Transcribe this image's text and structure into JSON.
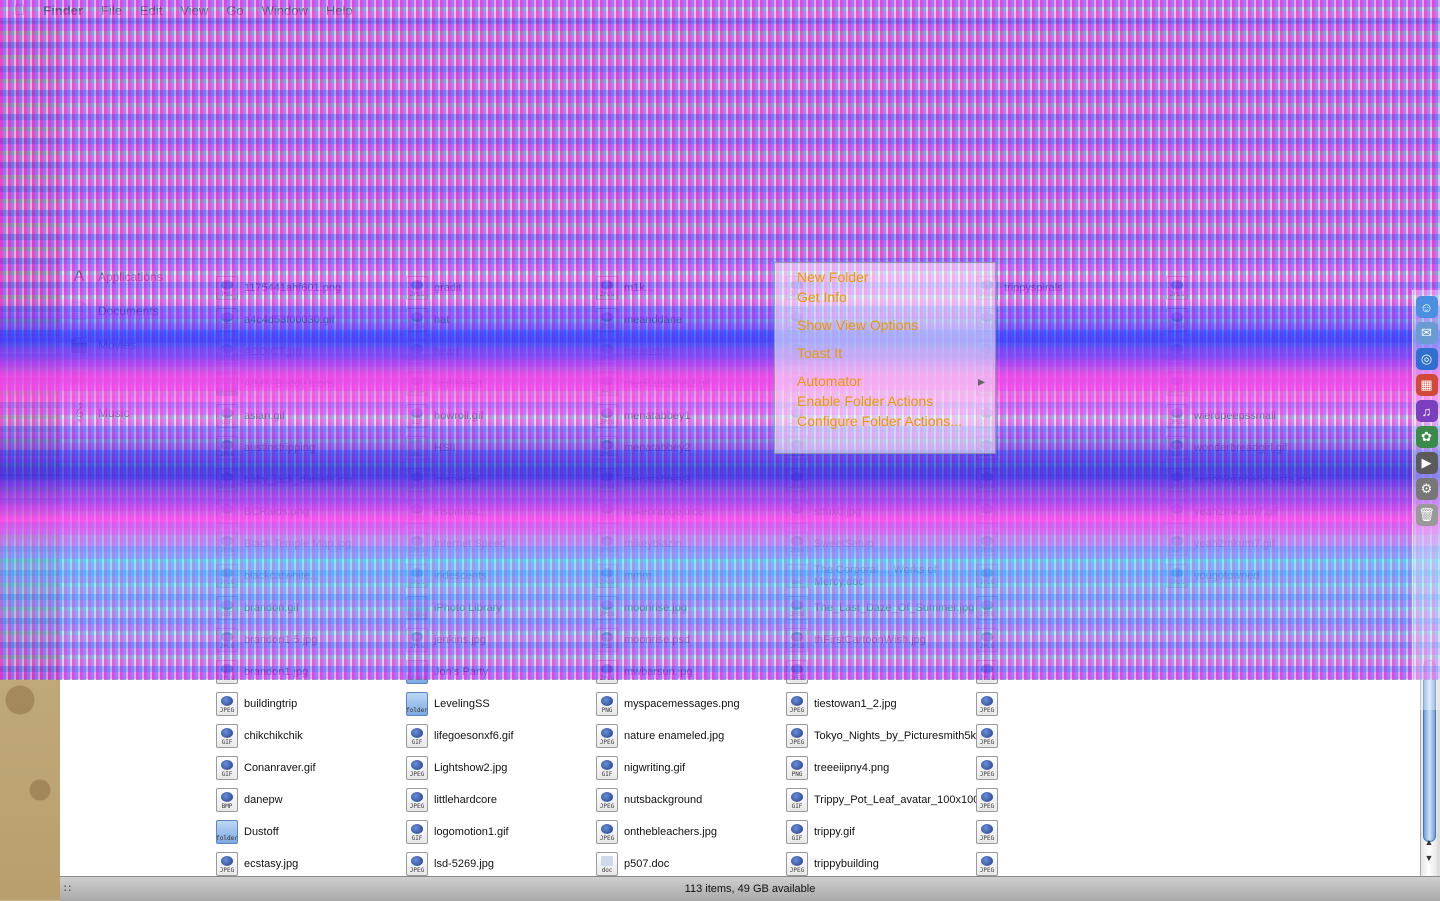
{
  "menubar": {
    "items": [
      "",
      "Finder",
      "File",
      "Edit",
      "View",
      "Go",
      "Window",
      "Help"
    ]
  },
  "sidebar": {
    "items": [
      {
        "label": "Applications",
        "icon": "applications-icon"
      },
      {
        "label": "Documents",
        "icon": "documents-icon"
      },
      {
        "label": "Movies",
        "icon": "movies-icon"
      },
      {
        "label": "",
        "icon": "folder-icon"
      },
      {
        "label": "Music",
        "icon": "music-icon"
      }
    ]
  },
  "files": [
    {
      "name": "1175441ahf601.png",
      "kind": "PNG"
    },
    {
      "name": "a4c4d53f00030.gif",
      "kind": "GIF"
    },
    {
      "name": "ADDICT.jpg",
      "kind": "JPEG"
    },
    {
      "name": "AIM® Buddy Icons",
      "kind": "folder"
    },
    {
      "name": "asian.gif",
      "kind": "GIF"
    },
    {
      "name": "austinstripping",
      "kind": "JPEG"
    },
    {
      "name": "baby_jack_daniels.jpg",
      "kind": "JPEG"
    },
    {
      "name": "BCRaids.png",
      "kind": "PNG"
    },
    {
      "name": "Black Temple Map.jpg",
      "kind": "JPEG"
    },
    {
      "name": "blackcatwhite...",
      "kind": "JPEG"
    },
    {
      "name": "brandon.gif",
      "kind": "GIF"
    },
    {
      "name": "brandon1.5.jpg",
      "kind": "JPEG"
    },
    {
      "name": "brandon1.jpg",
      "kind": "JPEG"
    },
    {
      "name": "buildingtrip",
      "kind": "JPEG"
    },
    {
      "name": "chikchikchik",
      "kind": "GIF"
    },
    {
      "name": "Conanraver.gif",
      "kind": "GIF"
    },
    {
      "name": "danepw",
      "kind": "BMP"
    },
    {
      "name": "Dustoff",
      "kind": "folder"
    },
    {
      "name": "ecstasy.jpg",
      "kind": "JPEG"
    },
    {
      "name": "gradit",
      "kind": "JPEG"
    },
    {
      "name": "hat",
      "kind": "JPEG"
    },
    {
      "name": "heart",
      "kind": "JPEG"
    },
    {
      "name": "highforest",
      "kind": "JPEG"
    },
    {
      "name": "howroll.gif",
      "kind": "GIF"
    },
    {
      "name": "HSII",
      "kind": "doc"
    },
    {
      "name": "imspecial",
      "kind": "JPEG"
    },
    {
      "name": "insomnia...",
      "kind": "JPEG"
    },
    {
      "name": "Internet Speed",
      "kind": "JPEG"
    },
    {
      "name": "iridescents",
      "kind": "JPEG"
    },
    {
      "name": "iPhoto Library",
      "kind": "folder"
    },
    {
      "name": "jenkins.jpg",
      "kind": "JPEG"
    },
    {
      "name": "Jon's Party",
      "kind": "folder"
    },
    {
      "name": "LevelingSS",
      "kind": "folder"
    },
    {
      "name": "lifegoesonxf6.gif",
      "kind": "GIF"
    },
    {
      "name": "Lightshow2.jpg",
      "kind": "JPEG"
    },
    {
      "name": "littlehardcore",
      "kind": "JPEG"
    },
    {
      "name": "logomotion1.gif",
      "kind": "GIF"
    },
    {
      "name": "lsd-5269.jpg",
      "kind": "JPEG"
    },
    {
      "name": "m1k...",
      "kind": "JPEG"
    },
    {
      "name": "meanddane",
      "kind": "JPEG"
    },
    {
      "name": "meaustin",
      "kind": "JPEG"
    },
    {
      "name": "meditate2this2.gif",
      "kind": "GIF"
    },
    {
      "name": "menatabbey1",
      "kind": "JPEG"
    },
    {
      "name": "menatabbey2",
      "kind": "JPEG"
    },
    {
      "name": "menatabbey3",
      "kind": "JPEG"
    },
    {
      "name": "mikeorangejuice",
      "kind": "JPEG"
    },
    {
      "name": "mikeyblazin...",
      "kind": "JPEG"
    },
    {
      "name": "mmm",
      "kind": "JPEG"
    },
    {
      "name": "moonrise.jpg",
      "kind": "JPEG"
    },
    {
      "name": "moonrise.psd",
      "kind": "PSD"
    },
    {
      "name": "mwbarsun.jpg",
      "kind": "JPEG"
    },
    {
      "name": "myspacemessages.png",
      "kind": "PNG"
    },
    {
      "name": "nature enameled.jpg",
      "kind": "JPEG"
    },
    {
      "name": "nigwriting.gif",
      "kind": "GIF"
    },
    {
      "name": "nutsbackground",
      "kind": "JPEG"
    },
    {
      "name": "onthebleachers.jpg",
      "kind": "JPEG"
    },
    {
      "name": "p507.doc",
      "kind": "doc"
    },
    {
      "name": "",
      "kind": "JPEG"
    },
    {
      "name": "",
      "kind": "JPEG"
    },
    {
      "name": "",
      "kind": "JPEG"
    },
    {
      "name": "",
      "kind": "JPEG"
    },
    {
      "name": "",
      "kind": "JPEG"
    },
    {
      "name": "",
      "kind": "JPEG"
    },
    {
      "name": "",
      "kind": "JPEG"
    },
    {
      "name": "stfux0.jpg",
      "kind": "JPEG"
    },
    {
      "name": "SweetSetup",
      "kind": "JPEG"
    },
    {
      "name": "The Corporal ... Works of Mercy.doc",
      "kind": "doc"
    },
    {
      "name": "The_Last_Daze_Of_Summer.jpg",
      "kind": "JPEG"
    },
    {
      "name": "thFirstCartoonWish.jpg",
      "kind": "JPEG"
    },
    {
      "name": "",
      "kind": "JPEG"
    },
    {
      "name": "tiestowan1_2.jpg",
      "kind": "JPEG"
    },
    {
      "name": "Tokyo_Nights_by_Picturesmith5k.jpg",
      "kind": "JPEG"
    },
    {
      "name": "treeeiipny4.png",
      "kind": "PNG"
    },
    {
      "name": "Trippy_Pot_Leaf_avatar_100x100_by_Intruder_Alert.gif",
      "kind": "GIF"
    },
    {
      "name": "trippy.gif",
      "kind": "GIF"
    },
    {
      "name": "trippybuilding",
      "kind": "JPEG"
    },
    {
      "name": "trippyspirals",
      "kind": "JPEG"
    },
    {
      "name": "",
      "kind": "JPEG"
    },
    {
      "name": "",
      "kind": "JPEG"
    },
    {
      "name": "",
      "kind": "JPEG"
    },
    {
      "name": "",
      "kind": "JPEG"
    },
    {
      "name": "",
      "kind": "JPEG"
    },
    {
      "name": "",
      "kind": "JPEG"
    },
    {
      "name": "",
      "kind": "JPEG"
    },
    {
      "name": "",
      "kind": "JPEG"
    },
    {
      "name": "",
      "kind": "JPEG"
    },
    {
      "name": "",
      "kind": "JPEG"
    },
    {
      "name": "",
      "kind": "JPEG"
    },
    {
      "name": "",
      "kind": "JPEG"
    },
    {
      "name": "",
      "kind": "JPEG"
    },
    {
      "name": "",
      "kind": "JPEG"
    },
    {
      "name": "",
      "kind": "JPEG"
    },
    {
      "name": "",
      "kind": "JPEG"
    },
    {
      "name": "",
      "kind": "JPEG"
    },
    {
      "name": "",
      "kind": "JPEG"
    },
    {
      "name": "",
      "kind": "JPEG"
    },
    {
      "name": "",
      "kind": "JPEG"
    },
    {
      "name": "",
      "kind": "JPEG"
    },
    {
      "name": "",
      "kind": "JPEG"
    },
    {
      "name": "wierdpeepssmall",
      "kind": "JPEG"
    },
    {
      "name": "wonderbreadgirl.gif",
      "kind": "GIF"
    },
    {
      "name": "xenoblospheric vista.jpg",
      "kind": "JPEG"
    },
    {
      "name": "yeah2mk.um7.gif",
      "kind": "GIF"
    },
    {
      "name": "yeah2mkum7.gif",
      "kind": "GIF"
    },
    {
      "name": "yougotowned",
      "kind": "JPEG"
    }
  ],
  "context_menu": {
    "items": [
      "New Folder",
      "Get Info",
      "",
      "Show View Options",
      "",
      "Toast It",
      "",
      "Automator",
      "Enable Folder Actions",
      "Configure Folder Actions..."
    ]
  },
  "statusbar": {
    "text": "113 items, 49 GB available"
  },
  "dock": {
    "icons": [
      "finder-icon",
      "mail-icon",
      "safari-icon",
      "ical-icon",
      "itunes-icon",
      "iphoto-icon",
      "imovie-icon",
      "preferences-icon",
      "trash-icon"
    ]
  },
  "colors": {
    "context_menu_text": "#e69b00",
    "selection_accent": "#6f9ed8"
  }
}
